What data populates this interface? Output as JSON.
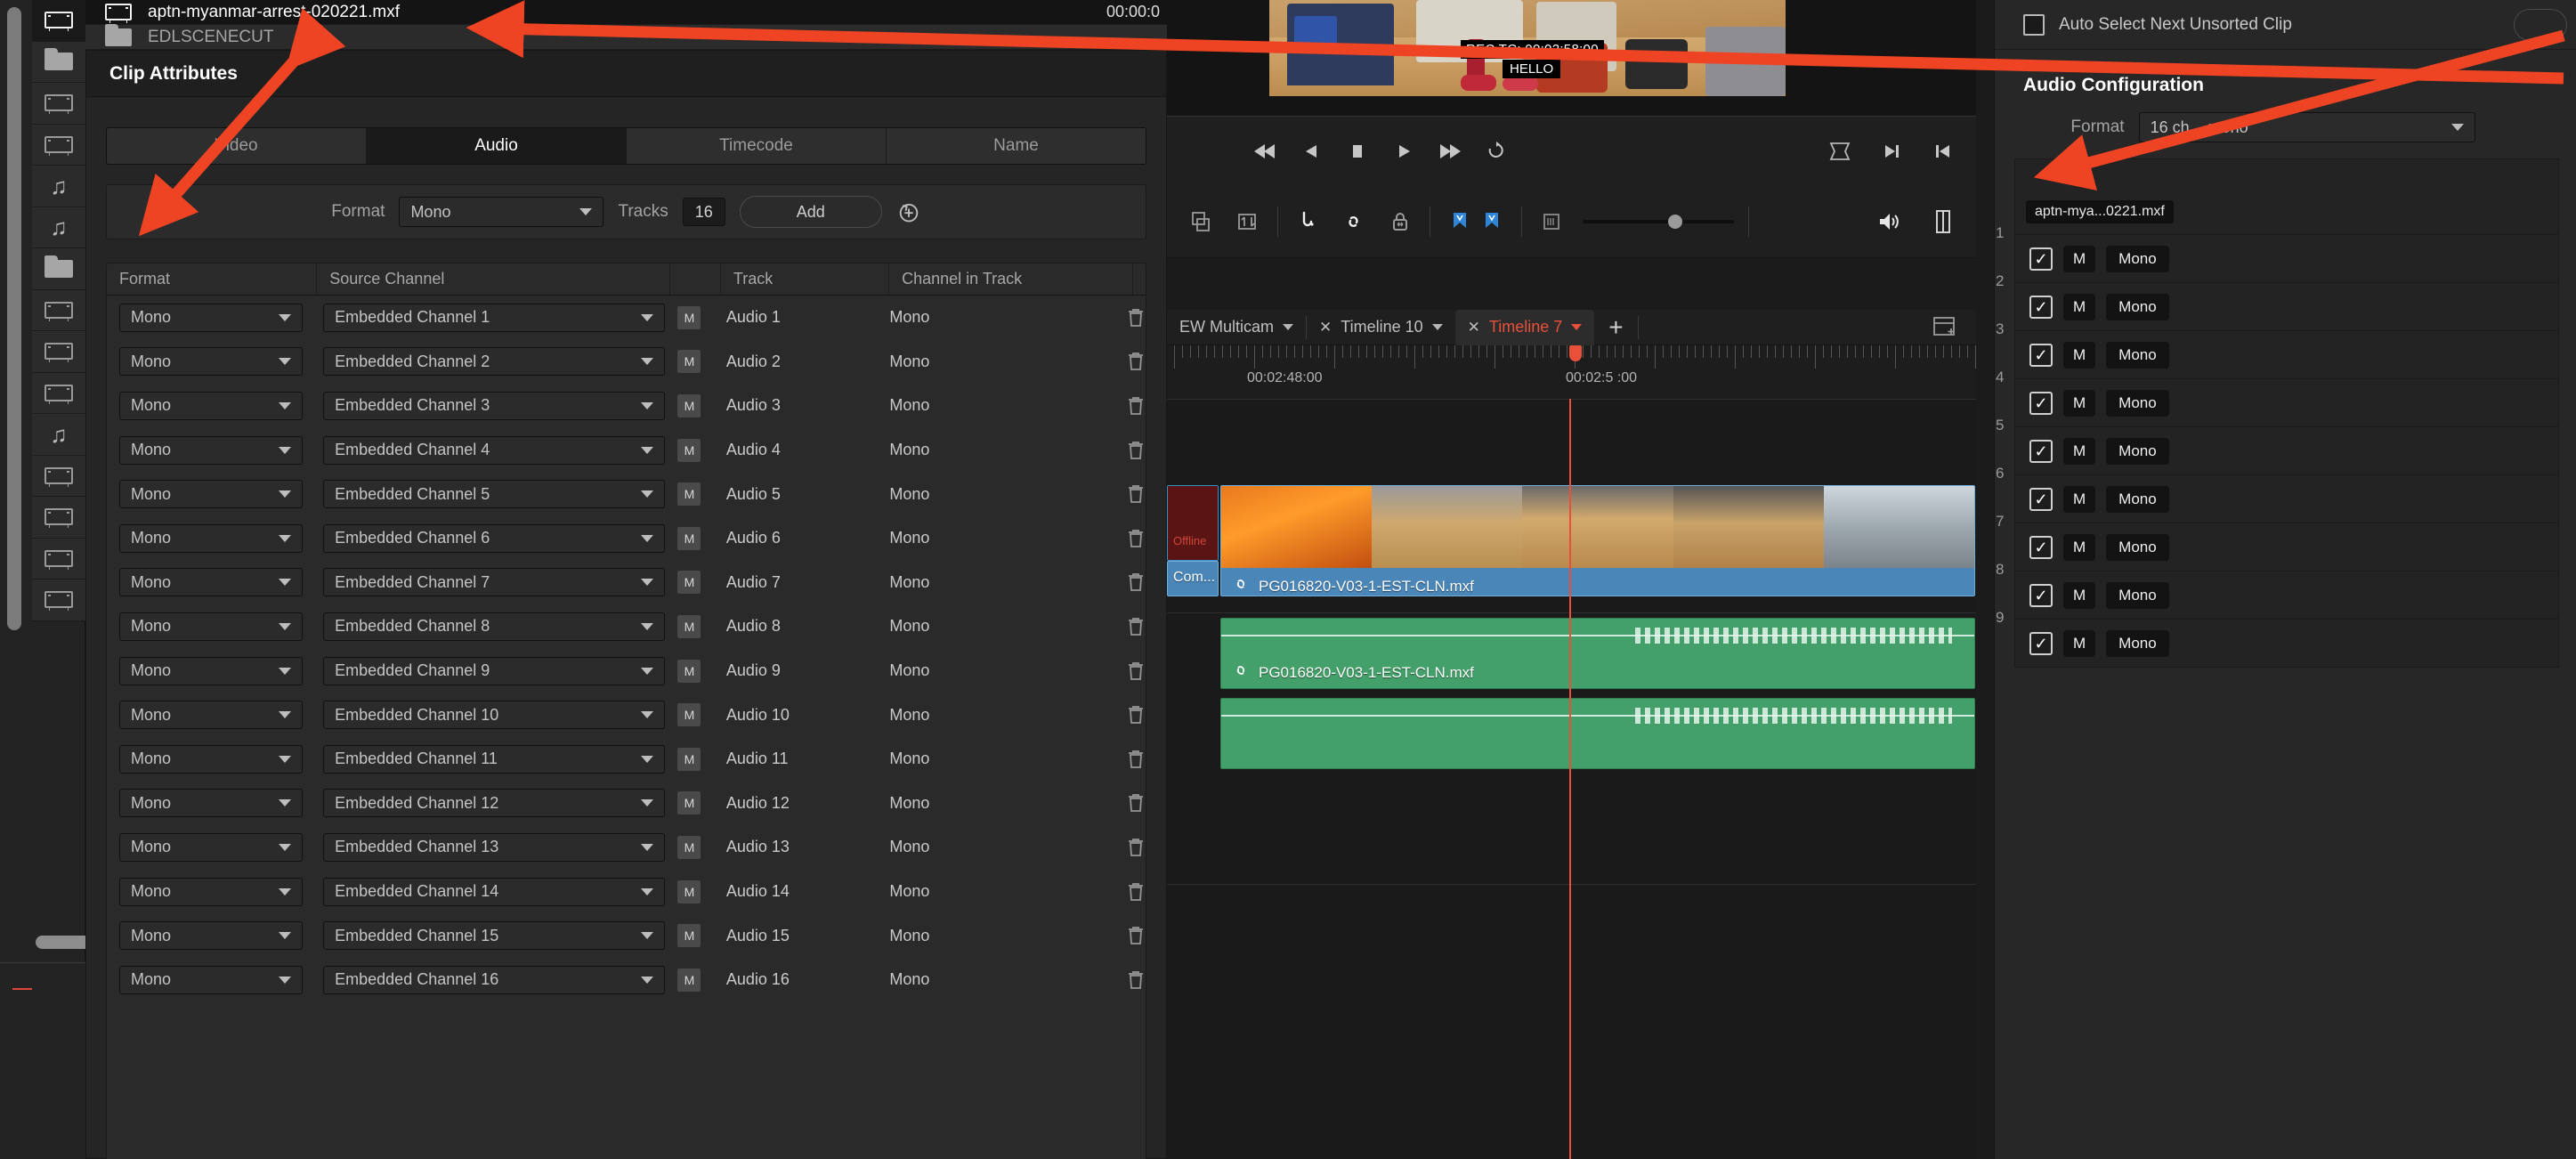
{
  "bin": {
    "rows": [
      {
        "icon": "film-icon",
        "label": "aptn-myanmar-arrest-020221.mxf",
        "timecode": "00:00:0",
        "selected": true
      },
      {
        "icon": "folder-icon",
        "label": "EDLSCENECUT",
        "timecode": "",
        "selected": false
      }
    ]
  },
  "left_rail": {
    "items": [
      {
        "icon": "film-icon",
        "selected": true
      },
      {
        "icon": "folder-icon",
        "selected": false
      },
      {
        "icon": "film-icon",
        "selected": false
      },
      {
        "icon": "film-icon",
        "selected": false
      },
      {
        "icon": "music-icon",
        "selected": false
      },
      {
        "icon": "music-icon",
        "selected": false
      },
      {
        "icon": "folder-icon",
        "selected": false
      },
      {
        "icon": "film-icon",
        "selected": false
      },
      {
        "icon": "film-icon",
        "selected": false
      },
      {
        "icon": "film-icon",
        "selected": false
      },
      {
        "icon": "music-icon",
        "selected": false
      },
      {
        "icon": "film-icon",
        "selected": false
      },
      {
        "icon": "film-icon",
        "selected": false
      },
      {
        "icon": "film-icon",
        "selected": false
      },
      {
        "icon": "film-icon",
        "selected": false
      }
    ]
  },
  "dialog": {
    "title": "Clip Attributes",
    "tabs": [
      {
        "label": "Video",
        "active": false
      },
      {
        "label": "Audio",
        "active": true
      },
      {
        "label": "Timecode",
        "active": false
      },
      {
        "label": "Name",
        "active": false
      }
    ],
    "controls": {
      "format_label": "Format",
      "format_value": "Mono",
      "tracks_label": "Tracks",
      "tracks_value": "16",
      "add_label": "Add",
      "reset_icon": "reset-icon"
    },
    "table": {
      "headers": [
        "Format",
        "Source Channel",
        "",
        "Track",
        "Channel in Track",
        ""
      ],
      "rows": [
        {
          "format": "Mono",
          "source": "Embedded Channel 1",
          "mute": "M",
          "track": "Audio 1",
          "channel": "Mono"
        },
        {
          "format": "Mono",
          "source": "Embedded Channel 2",
          "mute": "M",
          "track": "Audio 2",
          "channel": "Mono"
        },
        {
          "format": "Mono",
          "source": "Embedded Channel 3",
          "mute": "M",
          "track": "Audio 3",
          "channel": "Mono"
        },
        {
          "format": "Mono",
          "source": "Embedded Channel 4",
          "mute": "M",
          "track": "Audio 4",
          "channel": "Mono"
        },
        {
          "format": "Mono",
          "source": "Embedded Channel 5",
          "mute": "M",
          "track": "Audio 5",
          "channel": "Mono"
        },
        {
          "format": "Mono",
          "source": "Embedded Channel 6",
          "mute": "M",
          "track": "Audio 6",
          "channel": "Mono"
        },
        {
          "format": "Mono",
          "source": "Embedded Channel 7",
          "mute": "M",
          "track": "Audio 7",
          "channel": "Mono"
        },
        {
          "format": "Mono",
          "source": "Embedded Channel 8",
          "mute": "M",
          "track": "Audio 8",
          "channel": "Mono"
        },
        {
          "format": "Mono",
          "source": "Embedded Channel 9",
          "mute": "M",
          "track": "Audio 9",
          "channel": "Mono"
        },
        {
          "format": "Mono",
          "source": "Embedded Channel 10",
          "mute": "M",
          "track": "Audio 10",
          "channel": "Mono"
        },
        {
          "format": "Mono",
          "source": "Embedded Channel 11",
          "mute": "M",
          "track": "Audio 11",
          "channel": "Mono"
        },
        {
          "format": "Mono",
          "source": "Embedded Channel 12",
          "mute": "M",
          "track": "Audio 12",
          "channel": "Mono"
        },
        {
          "format": "Mono",
          "source": "Embedded Channel 13",
          "mute": "M",
          "track": "Audio 13",
          "channel": "Mono"
        },
        {
          "format": "Mono",
          "source": "Embedded Channel 14",
          "mute": "M",
          "track": "Audio 14",
          "channel": "Mono"
        },
        {
          "format": "Mono",
          "source": "Embedded Channel 15",
          "mute": "M",
          "track": "Audio 15",
          "channel": "Mono"
        },
        {
          "format": "Mono",
          "source": "Embedded Channel 16",
          "mute": "M",
          "track": "Audio 16",
          "channel": "Mono"
        }
      ]
    }
  },
  "viewer": {
    "rec_tc": "REC TC: 00:02:58:00",
    "overlay_text": "HELLO"
  },
  "transport": {
    "buttons": [
      "jump-to-start-icon",
      "step-back-icon",
      "stop-icon",
      "play-icon",
      "fast-forward-icon",
      "loop-icon"
    ],
    "right_buttons": [
      "fit-to-window-icon",
      "next-edit-icon",
      "previous-edit-icon"
    ]
  },
  "toolbar": {
    "buttons": [
      "insert-clip-icon",
      "swap-clip-icon",
      "snapping-icon",
      "linked-selection-icon",
      "lock-track-icon",
      "flag-marker-icon",
      "marker-icon",
      "volume-icon",
      "panel-toggle-icon"
    ],
    "slider_value": 56
  },
  "timeline": {
    "tabs": [
      {
        "label": "EW Multicam",
        "active": false,
        "closable": false
      },
      {
        "label": "Timeline 10",
        "active": false,
        "closable": true
      },
      {
        "label": "Timeline 7",
        "active": true,
        "closable": true
      }
    ],
    "add_tab_label": "+",
    "ruler_labels": [
      "00:02:48:00",
      "00:02:5 :00"
    ],
    "clips": [
      {
        "name": "Com...",
        "type": "offline",
        "badge": "Offline"
      },
      {
        "name": "PG016820-V03-1-EST-CLN.mxf",
        "type": "video"
      },
      {
        "name": "PG016820-V03-1-EST-CLN.mxf",
        "type": "audio"
      },
      {
        "name": "",
        "type": "audio"
      }
    ]
  },
  "right_panel": {
    "auto_select_label": "Auto Select Next Unsorted Clip",
    "auto_select_checked": false,
    "title": "Audio Configuration",
    "format_label": "Format",
    "format_value": "16 ch. - mono",
    "clip_chip": "aptn-mya...0221.mxf",
    "channels": [
      {
        "index": "1",
        "checked": true,
        "mute": "M",
        "format": "Mono"
      },
      {
        "index": "2",
        "checked": true,
        "mute": "M",
        "format": "Mono"
      },
      {
        "index": "3",
        "checked": true,
        "mute": "M",
        "format": "Mono"
      },
      {
        "index": "4",
        "checked": true,
        "mute": "M",
        "format": "Mono"
      },
      {
        "index": "5",
        "checked": true,
        "mute": "M",
        "format": "Mono"
      },
      {
        "index": "6",
        "checked": true,
        "mute": "M",
        "format": "Mono"
      },
      {
        "index": "7",
        "checked": true,
        "mute": "M",
        "format": "Mono"
      },
      {
        "index": "8",
        "checked": true,
        "mute": "M",
        "format": "Mono"
      },
      {
        "index": "9",
        "checked": true,
        "mute": "M",
        "format": "Mono"
      }
    ]
  },
  "annotations": {
    "arrow_color": "#ef4423",
    "count": 3
  }
}
